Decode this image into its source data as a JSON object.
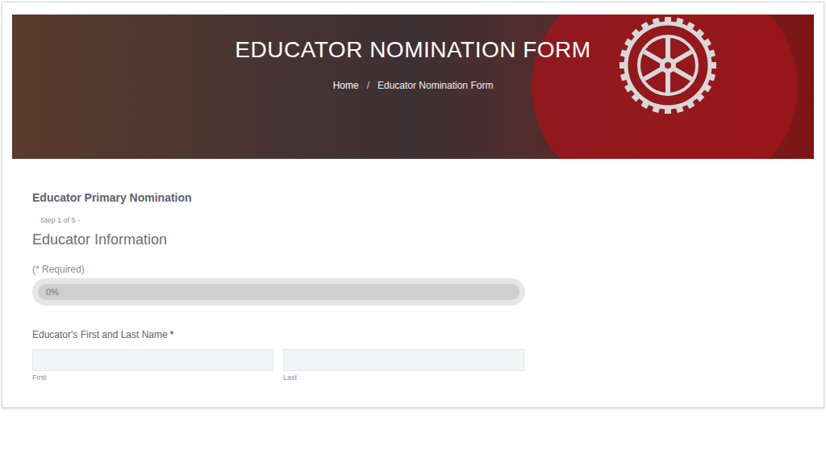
{
  "banner": {
    "title": "EDUCATOR NOMINATION FORM",
    "breadcrumb": [
      {
        "label": "Home",
        "current": false
      },
      {
        "label": "Educator Nomination Form",
        "current": true
      }
    ],
    "separator": "/"
  },
  "form": {
    "title": "Educator Primary Nomination",
    "step": "Step 1 of 5 -",
    "section": "Educator Information",
    "required_note": "(* Required)",
    "progress": {
      "level": 0,
      "label": "0%"
    },
    "fields": [
      {
        "label": "Educator's First and Last Name",
        "required": true,
        "required_mark": "*",
        "inputs": [
          {
            "sublabel": "First",
            "value": ""
          },
          {
            "sublabel": "Last",
            "value": ""
          }
        ]
      }
    ]
  }
}
